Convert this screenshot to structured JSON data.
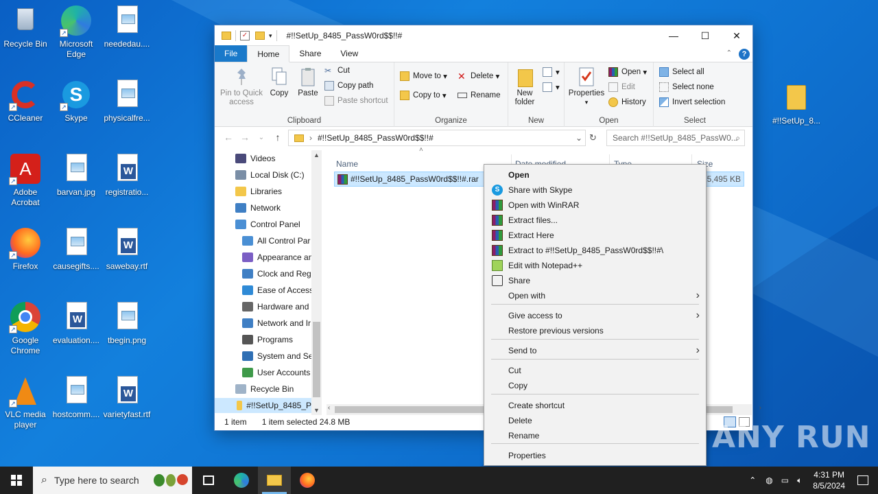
{
  "desktop": {
    "icons": [
      {
        "label": "Recycle Bin",
        "icon": "recycle-bin-icon"
      },
      {
        "label": "Microsoft Edge",
        "icon": "edge-icon"
      },
      {
        "label": "neededau....",
        "icon": "image-file-icon"
      },
      {
        "label": "CCleaner",
        "icon": "ccleaner-icon"
      },
      {
        "label": "Skype",
        "icon": "skype-icon"
      },
      {
        "label": "physicalfre...",
        "icon": "image-file-icon"
      },
      {
        "label": "Adobe Acrobat",
        "icon": "acrobat-icon"
      },
      {
        "label": "barvan.jpg",
        "icon": "image-file-icon"
      },
      {
        "label": "registratio...",
        "icon": "word-file-icon"
      },
      {
        "label": "Firefox",
        "icon": "firefox-icon"
      },
      {
        "label": "causegifts....",
        "icon": "image-file-icon"
      },
      {
        "label": "sawebay.rtf",
        "icon": "word-file-icon"
      },
      {
        "label": "Google Chrome",
        "icon": "chrome-icon"
      },
      {
        "label": "evaluation....",
        "icon": "word-file-icon"
      },
      {
        "label": "tbegin.png",
        "icon": "image-file-icon"
      },
      {
        "label": "VLC media player",
        "icon": "vlc-icon"
      },
      {
        "label": "hostcomm....",
        "icon": "image-file-icon"
      },
      {
        "label": "varietyfast.rtf",
        "icon": "word-file-icon"
      }
    ],
    "right_folder_label": "#!!SetUp_8..."
  },
  "window": {
    "title": "#!!SetUp_8485_PassW0rd$$!!#",
    "tabs": [
      "File",
      "Home",
      "Share",
      "View"
    ],
    "ribbon": {
      "clipboard": {
        "label": "Clipboard",
        "pin": "Pin to Quick access",
        "copy": "Copy",
        "paste": "Paste",
        "cut": "Cut",
        "copy_path": "Copy path",
        "paste_shortcut": "Paste shortcut"
      },
      "organize": {
        "label": "Organize",
        "move_to": "Move to",
        "copy_to": "Copy to",
        "delete": "Delete",
        "rename": "Rename"
      },
      "new": {
        "label": "New",
        "new_folder": "New folder"
      },
      "open": {
        "label": "Open",
        "properties": "Properties",
        "open": "Open",
        "edit": "Edit",
        "history": "History"
      },
      "select": {
        "label": "Select",
        "select_all": "Select all",
        "select_none": "Select none",
        "invert": "Invert selection"
      }
    },
    "address": "#!!SetUp_8485_PassW0rd$$!!#",
    "search_placeholder": "Search #!!SetUp_8485_PassW0...",
    "nav_items": [
      {
        "label": "Videos",
        "icon": "videos-icon"
      },
      {
        "label": "Local Disk (C:)",
        "icon": "disk-icon"
      },
      {
        "label": "Libraries",
        "icon": "libraries-icon"
      },
      {
        "label": "Network",
        "icon": "network-icon"
      },
      {
        "label": "Control Panel",
        "icon": "control-panel-icon"
      },
      {
        "label": "All Control Par",
        "icon": "control-panel-icon"
      },
      {
        "label": "Appearance an",
        "icon": "appearance-icon"
      },
      {
        "label": "Clock and Regi",
        "icon": "clock-icon"
      },
      {
        "label": "Ease of Access",
        "icon": "ease-of-access-icon"
      },
      {
        "label": "Hardware and",
        "icon": "hardware-icon"
      },
      {
        "label": "Network and Ir",
        "icon": "network-icon"
      },
      {
        "label": "Programs",
        "icon": "programs-icon"
      },
      {
        "label": "System and Se",
        "icon": "system-icon"
      },
      {
        "label": "User Accounts",
        "icon": "user-accounts-icon"
      },
      {
        "label": "Recycle Bin",
        "icon": "recycle-bin-icon"
      },
      {
        "label": "#!!SetUp_8485_P",
        "icon": "folder-icon"
      }
    ],
    "columns": [
      "Name",
      "Date modified",
      "Type",
      "Size"
    ],
    "file": {
      "name": "#!!SetUp_8485_PassW0rd$$!!#.rar",
      "size": "25,495 KB"
    },
    "status": {
      "count": "1 item",
      "selected": "1 item selected  24.8 MB"
    }
  },
  "context_menu": {
    "items": [
      {
        "label": "Open",
        "bold": true,
        "icon": ""
      },
      {
        "label": "Share with Skype",
        "icon": "skype-icon"
      },
      {
        "label": "Open with WinRAR",
        "icon": "winrar-icon"
      },
      {
        "label": "Extract files...",
        "icon": "winrar-icon"
      },
      {
        "label": "Extract Here",
        "icon": "winrar-icon"
      },
      {
        "label": "Extract to #!!SetUp_8485_PassW0rd$$!!#\\",
        "icon": "winrar-icon"
      },
      {
        "label": "Edit with Notepad++",
        "icon": "notepad-plus-icon"
      },
      {
        "label": "Share",
        "icon": "share-icon"
      },
      {
        "label": "Open with",
        "submenu": true
      },
      {
        "label": "Give access to",
        "submenu": true
      },
      {
        "label": "Restore previous versions"
      },
      {
        "label": "Send to",
        "submenu": true
      },
      {
        "label": "Cut"
      },
      {
        "label": "Copy"
      },
      {
        "label": "Create shortcut"
      },
      {
        "label": "Delete"
      },
      {
        "label": "Rename"
      },
      {
        "label": "Properties"
      }
    ]
  },
  "taskbar": {
    "search_placeholder": "Type here to search",
    "time": "4:31 PM",
    "date": "8/5/2024"
  },
  "watermark": "ANY RUN"
}
